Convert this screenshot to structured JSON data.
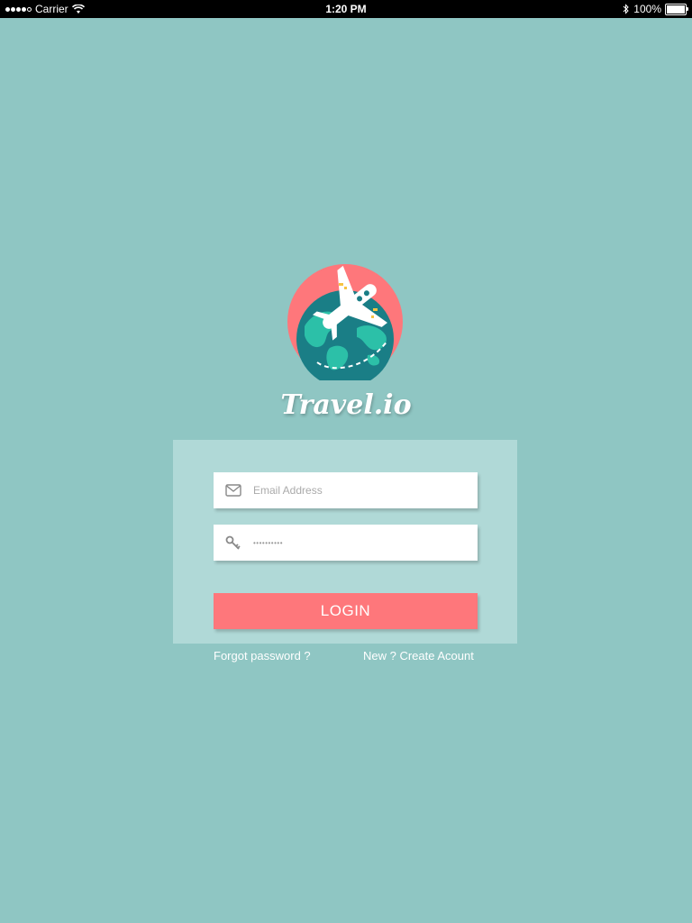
{
  "status_bar": {
    "carrier": "Carrier",
    "time": "1:20 PM",
    "battery": "100%"
  },
  "brand": {
    "name": "Travel.io"
  },
  "form": {
    "email_placeholder": "Email Address",
    "password_value": "••••••••••",
    "login_label": "LOGIN"
  },
  "links": {
    "forgot": "Forgot password ?",
    "create": "New ? Create Acount"
  },
  "colors": {
    "background": "#8fc6c3",
    "panel": "#b0d9d7",
    "accent": "#fe777b"
  },
  "icons": {
    "email": "envelope-icon",
    "password": "key-icon",
    "logo": "globe-airplane-logo"
  }
}
